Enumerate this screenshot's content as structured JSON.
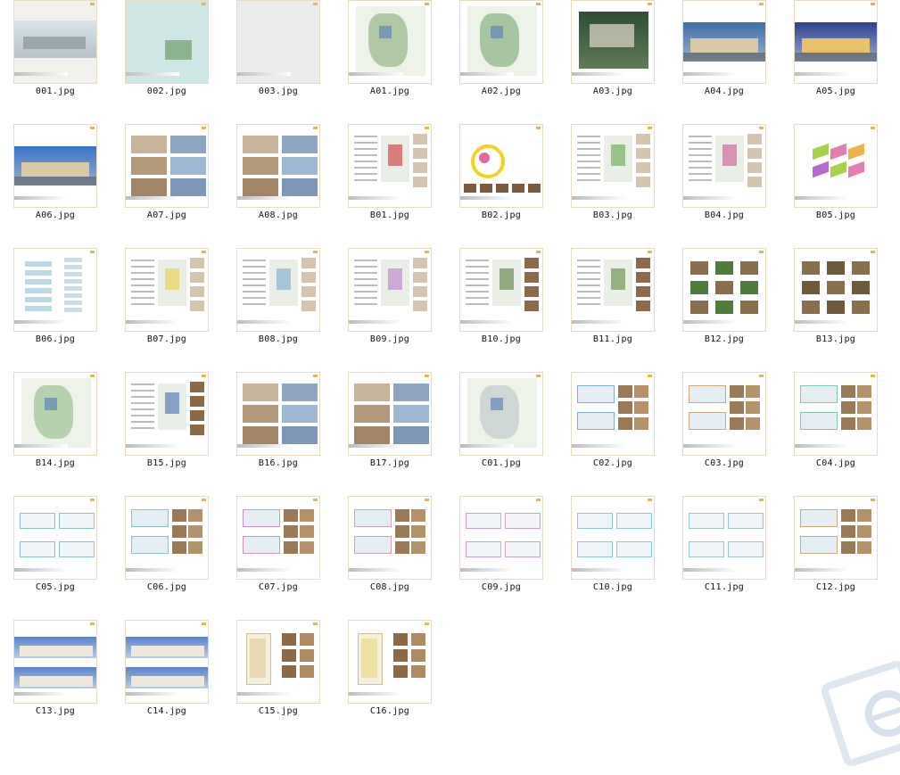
{
  "window": {
    "view": "thumbnails"
  },
  "files": [
    {
      "name": "001.jpg",
      "kind": "cover-photo",
      "bg": "#f3f1ee",
      "accent": "#9db6c9"
    },
    {
      "name": "002.jpg",
      "kind": "teal",
      "bg": "#cfe7e4",
      "accent": "#7fb7b0"
    },
    {
      "name": "003.jpg",
      "kind": "blank",
      "bg": "#ececec",
      "accent": "#d6d6d6"
    },
    {
      "name": "A01.jpg",
      "kind": "site-plan",
      "bg": "#ffffff",
      "accent": "#7fa46b"
    },
    {
      "name": "A02.jpg",
      "kind": "site-plan",
      "bg": "#ffffff",
      "accent": "#6e9f63"
    },
    {
      "name": "A03.jpg",
      "kind": "aerial-photo",
      "bg": "#ffffff",
      "accent": "#3d5f3d"
    },
    {
      "name": "A04.jpg",
      "kind": "building-photo",
      "bg": "#ffffff",
      "accent": "#3e6fa8"
    },
    {
      "name": "A05.jpg",
      "kind": "night-photo",
      "bg": "#ffffff",
      "accent": "#2d3f8f"
    },
    {
      "name": "A06.jpg",
      "kind": "building-photo",
      "bg": "#ffffff",
      "accent": "#3b73c9"
    },
    {
      "name": "A07.jpg",
      "kind": "photo-grid",
      "bg": "#ffffff",
      "accent": "#7b95b9"
    },
    {
      "name": "A08.jpg",
      "kind": "photo-grid",
      "bg": "#ffffff",
      "accent": "#8aa3c5"
    },
    {
      "name": "B01.jpg",
      "kind": "text-map",
      "bg": "#ffffff",
      "accent": "#d04d4d"
    },
    {
      "name": "B02.jpg",
      "kind": "diagram-circle",
      "bg": "#ffffff",
      "accent": "#f2d21f"
    },
    {
      "name": "B03.jpg",
      "kind": "text-map",
      "bg": "#ffffff",
      "accent": "#73b25a"
    },
    {
      "name": "B04.jpg",
      "kind": "text-map",
      "bg": "#ffffff",
      "accent": "#cf6a9c"
    },
    {
      "name": "B05.jpg",
      "kind": "iso-diagram",
      "bg": "#ffffff",
      "accent": "#9fc94a"
    },
    {
      "name": "B06.jpg",
      "kind": "sections",
      "bg": "#ffffff",
      "accent": "#7ab0c8"
    },
    {
      "name": "B07.jpg",
      "kind": "text-map",
      "bg": "#ffffff",
      "accent": "#e6d35b"
    },
    {
      "name": "B08.jpg",
      "kind": "text-map",
      "bg": "#ffffff",
      "accent": "#8ab3d1"
    },
    {
      "name": "B09.jpg",
      "kind": "text-map",
      "bg": "#ffffff",
      "accent": "#c58ad1"
    },
    {
      "name": "B10.jpg",
      "kind": "photo-map",
      "bg": "#ffffff",
      "accent": "#6c8b57"
    },
    {
      "name": "B11.jpg",
      "kind": "photo-map",
      "bg": "#ffffff",
      "accent": "#6f9a55"
    },
    {
      "name": "B12.jpg",
      "kind": "photo-scatter",
      "bg": "#ffffff",
      "accent": "#4f7c3b"
    },
    {
      "name": "B13.jpg",
      "kind": "photo-scatter",
      "bg": "#ffffff",
      "accent": "#6d5a3b"
    },
    {
      "name": "B14.jpg",
      "kind": "site-plan",
      "bg": "#ffffff",
      "accent": "#89b57a"
    },
    {
      "name": "B15.jpg",
      "kind": "photo-map",
      "bg": "#ffffff",
      "accent": "#5f7fb8"
    },
    {
      "name": "B16.jpg",
      "kind": "photo-grid",
      "bg": "#ffffff",
      "accent": "#8a5b3e"
    },
    {
      "name": "B17.jpg",
      "kind": "photo-grid",
      "bg": "#ffffff",
      "accent": "#8c5a3c"
    },
    {
      "name": "C01.jpg",
      "kind": "site-plan",
      "bg": "#ffffff",
      "accent": "#b7c0c3"
    },
    {
      "name": "C02.jpg",
      "kind": "plan-photos",
      "bg": "#ffffff",
      "accent": "#7fb0c9"
    },
    {
      "name": "C03.jpg",
      "kind": "plan-photos",
      "bg": "#ffffff",
      "accent": "#c9a97f"
    },
    {
      "name": "C04.jpg",
      "kind": "plan-photos",
      "bg": "#ffffff",
      "accent": "#7fc9b0"
    },
    {
      "name": "C05.jpg",
      "kind": "floor-plans",
      "bg": "#ffffff",
      "accent": "#8ec0d8"
    },
    {
      "name": "C06.jpg",
      "kind": "plan-photos",
      "bg": "#ffffff",
      "accent": "#8ec0d8"
    },
    {
      "name": "C07.jpg",
      "kind": "plan-photos",
      "bg": "#ffffff",
      "accent": "#d88ec0"
    },
    {
      "name": "C08.jpg",
      "kind": "plan-photos",
      "bg": "#ffffff",
      "accent": "#d8a0b8"
    },
    {
      "name": "C09.jpg",
      "kind": "floor-plans",
      "bg": "#ffffff",
      "accent": "#d89ec8"
    },
    {
      "name": "C10.jpg",
      "kind": "floor-plans",
      "bg": "#ffffff",
      "accent": "#8ec8d8"
    },
    {
      "name": "C11.jpg",
      "kind": "floor-plans",
      "bg": "#ffffff",
      "accent": "#9ec0e0"
    },
    {
      "name": "C12.jpg",
      "kind": "plan-photos",
      "bg": "#ffffff",
      "accent": "#c9a97f"
    },
    {
      "name": "C13.jpg",
      "kind": "elevations",
      "bg": "#ffffff",
      "accent": "#5c84c8"
    },
    {
      "name": "C14.jpg",
      "kind": "elevations",
      "bg": "#ffffff",
      "accent": "#5c84c8"
    },
    {
      "name": "C15.jpg",
      "kind": "section-photos",
      "bg": "#ffffff",
      "accent": "#e0c28a"
    },
    {
      "name": "C16.jpg",
      "kind": "section-photos",
      "bg": "#ffffff",
      "accent": "#e8d36a"
    }
  ]
}
